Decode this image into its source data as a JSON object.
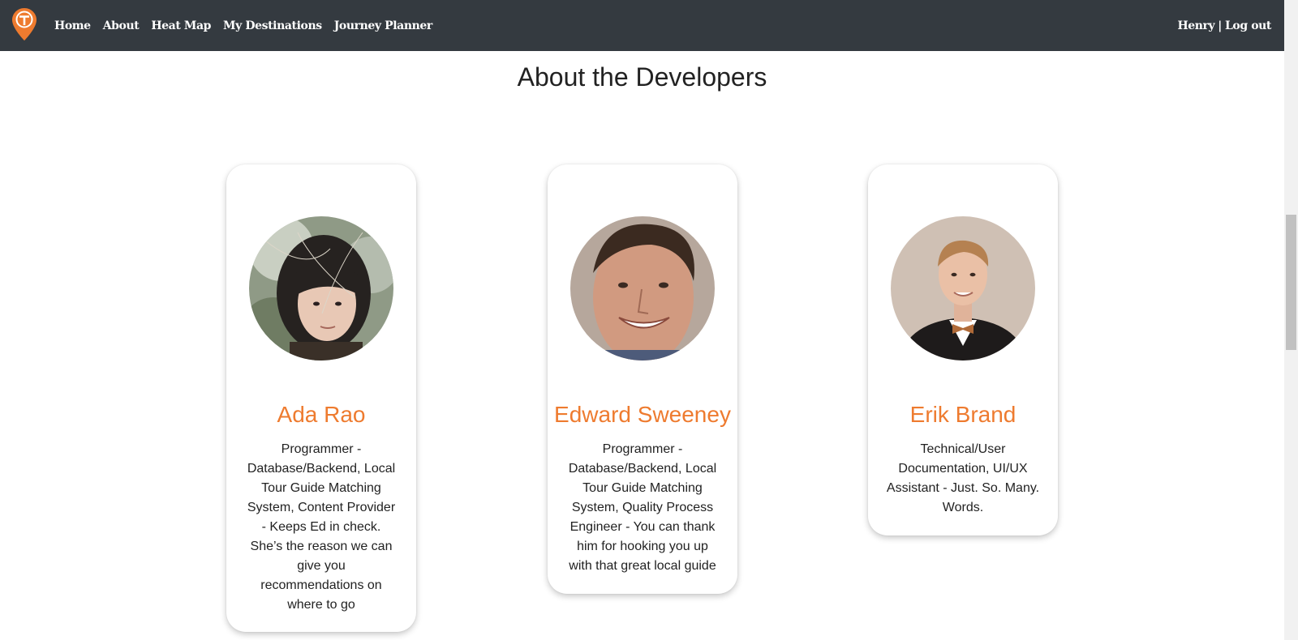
{
  "nav": {
    "links": [
      "Home",
      "About",
      "Heat Map",
      "My Destinations",
      "Journey Planner"
    ],
    "user": "Henry",
    "separator": "|",
    "logout": "Log out",
    "brand_color": "#ee7b2f"
  },
  "page": {
    "title": "About the Developers"
  },
  "developers": [
    {
      "name": "Ada Rao",
      "description": "Programmer - Database/Backend, Local Tour Guide Matching System, Content Provider - Keeps Ed in check. She’s the reason we can give you recommendations on where to go"
    },
    {
      "name": "Edward Sweeney",
      "description": "Programmer - Database/Backend, Local Tour Guide Matching System, Quality Process Engineer - You can thank him for hooking you up with that great local guide"
    },
    {
      "name": "Erik Brand",
      "description": "Technical/User Documentation, UI/UX Assistant - Just. So. Many. Words."
    }
  ],
  "colors": {
    "accent": "#ee7b2f",
    "navbar": "#343a40"
  }
}
